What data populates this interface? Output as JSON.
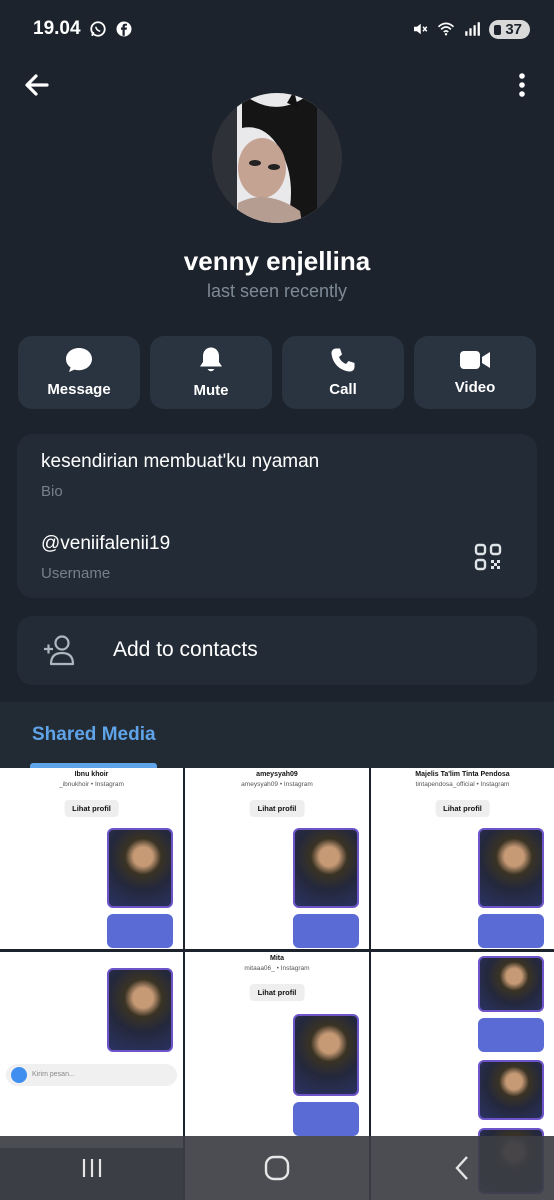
{
  "status_bar": {
    "time": "19.04",
    "battery": "37",
    "icons": [
      "whatsapp-icon",
      "facebook-icon",
      "mute-icon",
      "wifi-icon",
      "signal-icon",
      "battery-icon"
    ]
  },
  "topbar": {
    "icons": [
      "back-arrow-icon",
      "more-vert-icon"
    ]
  },
  "profile": {
    "name": "venny enjellina",
    "status": "last seen recently"
  },
  "actions": [
    {
      "label": "Message",
      "icon": "message-icon"
    },
    {
      "label": "Mute",
      "icon": "bell-icon"
    },
    {
      "label": "Call",
      "icon": "phone-icon"
    },
    {
      "label": "Video",
      "icon": "video-icon"
    }
  ],
  "info": {
    "bio": "kesendirian membuat'ku nyaman",
    "bio_label": "Bio",
    "username": "@veniifalenii19",
    "username_label": "Username"
  },
  "add_contact": {
    "label": "Add to contacts",
    "icon": "add-person-icon"
  },
  "shared": {
    "tab_label": "Shared Media"
  },
  "media": [
    {
      "name": "Ibnu khoir",
      "sub": "_ibnukhoir • Instagram",
      "button": "Lihat profil"
    },
    {
      "name": "ameysyah09",
      "sub": "ameysyah09 • Instagram",
      "button": "Lihat profil"
    },
    {
      "name": "Majelis Ta'lim Tinta Pendosa",
      "sub": "tintapendosa_official • Instagram",
      "button": "Lihat profil"
    },
    {
      "input_placeholder": "Kirim pesan..."
    },
    {
      "name": "Mita",
      "sub": "mitaaa06_ • Instagram",
      "button": "Lihat profil"
    },
    {}
  ],
  "colors": {
    "background": "#1c232c",
    "card": "#232c36",
    "accent": "#5fa3e8",
    "muted_text": "#7f8a97"
  }
}
